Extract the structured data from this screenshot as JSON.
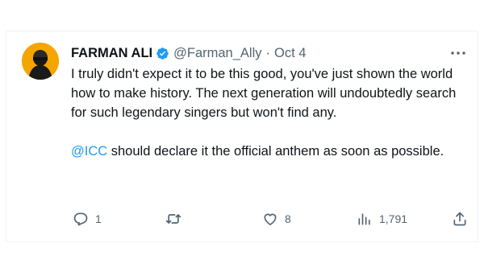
{
  "tweet": {
    "author_name": "FARMAN ALI",
    "handle": "@Farman_Ally",
    "separator": "·",
    "date": "Oct 4",
    "paragraph1": "I truly didn't expect it to be this good, you've just shown the world how to make history. The next generation will undoubtedly search for such legendary singers but won't find any.",
    "mention": "@ICC",
    "paragraph2_rest": " should declare it the official anthem as soon as possible."
  },
  "actions": {
    "replies": "1",
    "retweets": "",
    "likes": "8",
    "views": "1,791"
  },
  "icons": {
    "verified": "verified-badge-icon",
    "more": "more-dots-icon",
    "reply": "reply-icon",
    "retweet": "retweet-icon",
    "like": "heart-icon",
    "views": "analytics-icon",
    "share": "share-icon"
  },
  "colors": {
    "accent": "#1d9bf0",
    "text": "#0f1419",
    "muted": "#536471",
    "avatar_bg": "#f5a500"
  }
}
